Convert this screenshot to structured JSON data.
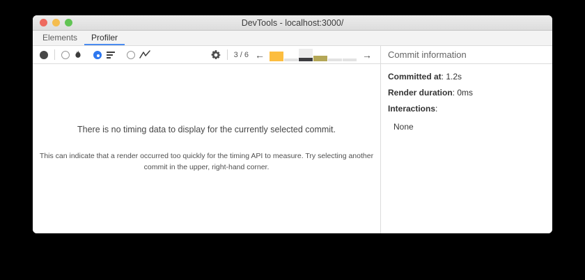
{
  "window_title": "DevTools - localhost:3000/",
  "traffic_lights": {
    "close": "#ee6a5f",
    "minimize": "#f5bd4f",
    "zoom": "#61c454"
  },
  "tabs": [
    {
      "label": "Elements",
      "selected": false
    },
    {
      "label": "Profiler",
      "selected": true
    }
  ],
  "toolbar": {
    "commit_position": "3 / 6",
    "prev_arrow": "←",
    "next_arrow": "→",
    "icons": [
      "record-icon",
      "flamegraph-icon",
      "ranked-chart-icon",
      "interactions-icon",
      "gear-icon"
    ],
    "accent_blue": "#2e78ef"
  },
  "commit_bars": [
    {
      "height": 14,
      "color": "#fcbd3f",
      "selected": false
    },
    {
      "height": 4,
      "color": "#e2e2e2",
      "selected": false
    },
    {
      "height": 5,
      "color": "#3d3d40",
      "selected": true
    },
    {
      "height": 8,
      "color": "#b4a757",
      "selected": false
    },
    {
      "height": 4,
      "color": "#e2e2e2",
      "selected": false
    },
    {
      "height": 4,
      "color": "#e2e2e2",
      "selected": false
    }
  ],
  "main": {
    "primary_message": "There is no timing data to display for the currently selected commit.",
    "secondary_message": "This can indicate that a render occurred too quickly for the timing API to measure. Try selecting another commit in the upper, right-hand corner."
  },
  "commit_info": {
    "header": "Commit information",
    "rows": [
      {
        "label": "Committed at",
        "value": ": 1.2s"
      },
      {
        "label": "Render duration",
        "value": ": 0ms"
      },
      {
        "label": "Interactions",
        "value": ":"
      }
    ],
    "empty_value": "None"
  }
}
